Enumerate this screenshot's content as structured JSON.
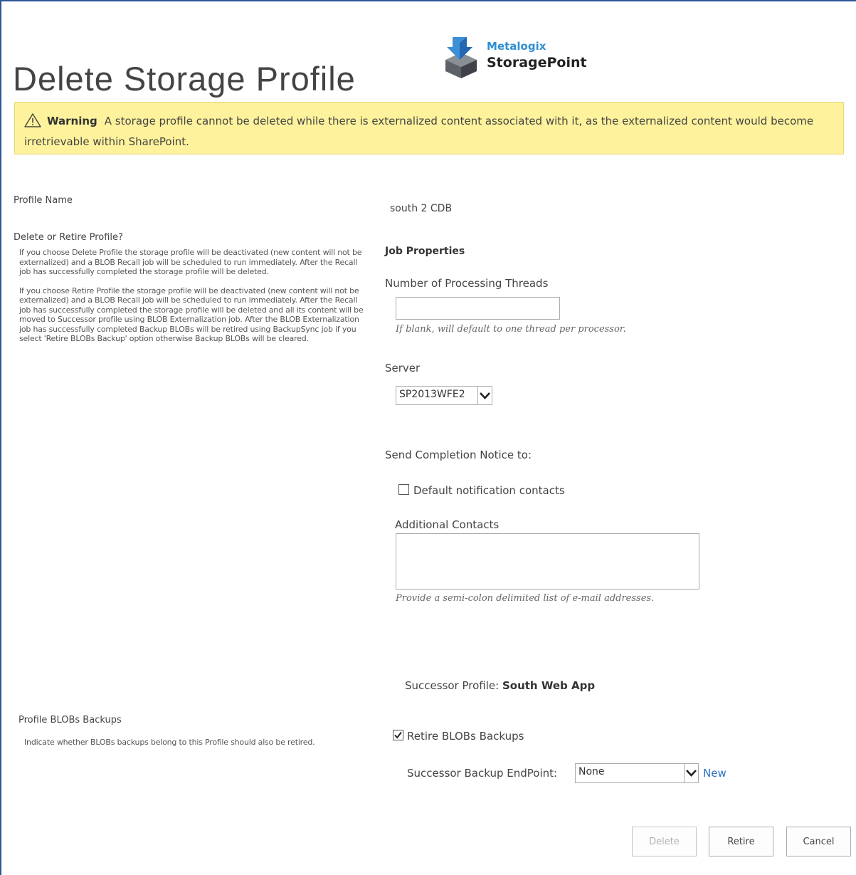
{
  "page": {
    "title": "Delete Storage Profile"
  },
  "logo": {
    "brand": "Metalogix",
    "product": "StoragePoint"
  },
  "warning": {
    "title": "Warning",
    "message": "A storage profile cannot be deleted while there is externalized content associated with it, as the externalized content would become irretrievable within SharePoint."
  },
  "left": {
    "profile_name_label": "Profile Name",
    "delete_retire_label": "Delete or Retire Profile?",
    "delete_retire_desc_1": "If you choose Delete Profile the storage profile will be deactivated (new content will not be externalized) and a BLOB Recall job will be scheduled to run immediately. After the Recall job has successfully completed the storage profile will be deleted.",
    "delete_retire_desc_2": "If you choose Retire Profile the storage profile will be deactivated (new content will not be externalized) and a BLOB Recall job will be scheduled to run immediately. After the Recall job has successfully completed the storage profile will be deleted and all its content will be moved to Successor profile using BLOB Externalization job. After the BLOB Externalization job has successfully completed Backup BLOBs will be retired using BackupSync job if you select 'Retire BLOBs Backup' option otherwise Backup BLOBs will be cleared.",
    "backups_label": "Profile BLOBs Backups",
    "backups_desc": "Indicate whether BLOBs backups belong to this Profile should also be retired."
  },
  "right": {
    "profile_name_value": "south 2 CDB",
    "job_properties_heading": "Job Properties",
    "threads_label": "Number of Processing Threads",
    "threads_value": "",
    "threads_hint": "If blank, will default to one thread per processor.",
    "server_label": "Server",
    "server_value": "SP2013WFE2",
    "send_notice_label": "Send Completion Notice to:",
    "default_contacts_label": "Default notification contacts",
    "default_contacts_checked": false,
    "additional_contacts_label": "Additional Contacts",
    "additional_contacts_value": "",
    "additional_contacts_hint": "Provide a semi-colon delimited list of e-mail addresses.",
    "successor_profile_label": "Successor Profile:",
    "successor_profile_value": "South Web App",
    "retire_backups_label": "Retire BLOBs Backups",
    "retire_backups_checked": true,
    "successor_endpoint_label": "Successor Backup EndPoint:",
    "successor_endpoint_value": "None",
    "new_link": "New"
  },
  "buttons": {
    "delete": "Delete",
    "retire": "Retire",
    "cancel": "Cancel"
  },
  "colors": {
    "frame": "#2b5797",
    "warning_bg": "#fff29c",
    "link": "#2a72c0",
    "brand": "#2f8fd4"
  },
  "icons": {
    "logo": "storagepoint-logo-icon",
    "warning": "warning-triangle-icon",
    "dropdown": "chevron-down-icon",
    "check": "checkmark-icon"
  }
}
